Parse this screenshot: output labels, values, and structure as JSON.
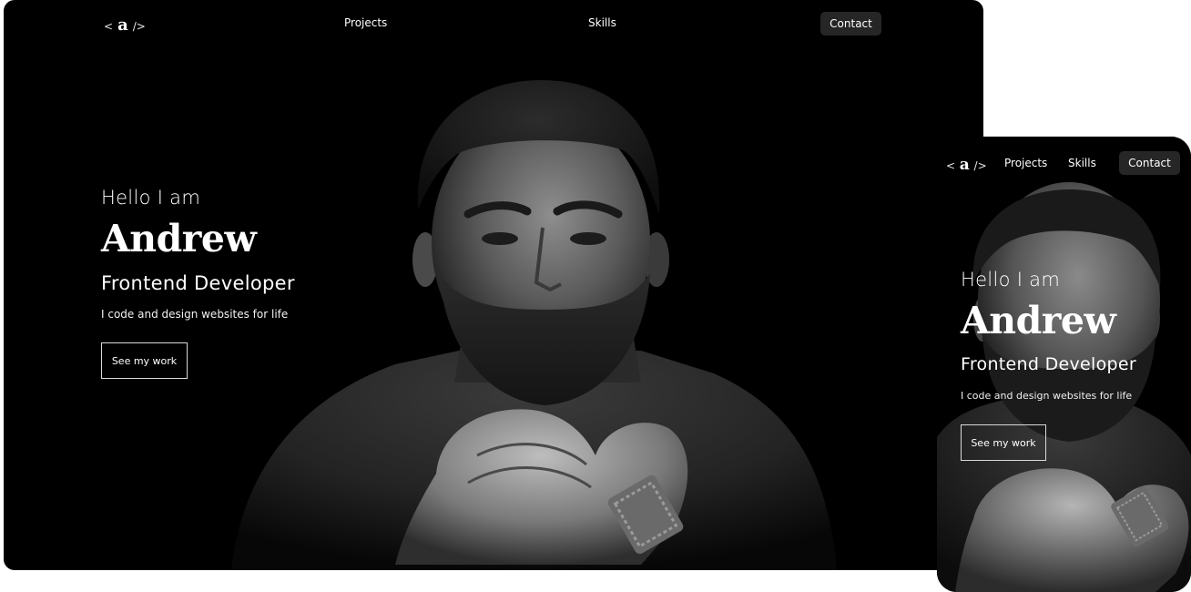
{
  "nav": {
    "logo_open": "<",
    "logo_letter": "a",
    "logo_close": "/>",
    "links": [
      {
        "label": "Projects"
      },
      {
        "label": "Skills"
      }
    ],
    "contact_label": "Contact"
  },
  "hero": {
    "greeting": "Hello I am",
    "name": "Andrew",
    "role": "Frontend Developer",
    "tagline": "I code and design websites for life",
    "cta_label": "See my work"
  },
  "colors": {
    "background": "#000000",
    "text": "#ffffff",
    "contact_button": "#262626",
    "cta_border": "#d9d9d9"
  },
  "icons": [
    "logo-mark"
  ]
}
